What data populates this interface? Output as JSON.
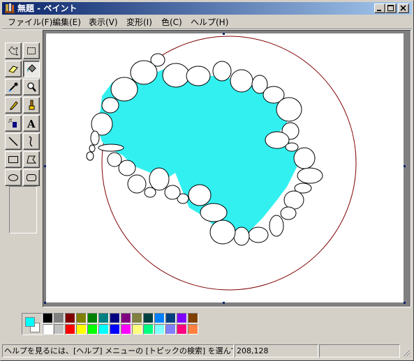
{
  "window": {
    "title": "無題 - ペイント",
    "app_icon": "paint-icon",
    "controls": [
      "minimize-icon",
      "maximize-icon",
      "close-icon"
    ]
  },
  "menu": [
    {
      "label": "ファイル(F)"
    },
    {
      "label": "編集(E)"
    },
    {
      "label": "表示(V)"
    },
    {
      "label": "変形(I)"
    },
    {
      "label": "色(C)"
    },
    {
      "label": "ヘルプ(H)"
    }
  ],
  "tools": [
    {
      "name": "free-select-icon",
      "active": false
    },
    {
      "name": "rect-select-icon",
      "active": false
    },
    {
      "name": "eraser-icon",
      "active": false
    },
    {
      "name": "fill-bucket-icon",
      "active": true
    },
    {
      "name": "color-picker-icon",
      "active": false
    },
    {
      "name": "magnifier-icon",
      "active": false
    },
    {
      "name": "pencil-icon",
      "active": false
    },
    {
      "name": "brush-icon",
      "active": false
    },
    {
      "name": "airbrush-icon",
      "active": false
    },
    {
      "name": "text-icon",
      "active": false,
      "glyph": "A"
    },
    {
      "name": "line-icon",
      "active": false
    },
    {
      "name": "curve-icon",
      "active": false
    },
    {
      "name": "rectangle-icon",
      "active": false
    },
    {
      "name": "polygon-icon",
      "active": false
    },
    {
      "name": "ellipse-icon",
      "active": false
    },
    {
      "name": "rounded-rect-icon",
      "active": false
    }
  ],
  "colors": {
    "foreground": "#00ffff",
    "background": "#ffffff",
    "fill": "#33f0f0",
    "circle_stroke": "#800000",
    "palette_row1": [
      "#000000",
      "#808080",
      "#800000",
      "#808000",
      "#008000",
      "#008080",
      "#000080",
      "#800080",
      "#808040",
      "#004040",
      "#0080ff",
      "#004080",
      "#8000ff",
      "#804000"
    ],
    "palette_row2": [
      "#ffffff",
      "#c0c0c0",
      "#ff0000",
      "#ffff00",
      "#00ff00",
      "#00ffff",
      "#0000ff",
      "#ff00ff",
      "#ffff80",
      "#00ff80",
      "#80ffff",
      "#8080ff",
      "#ff0080",
      "#ff8040"
    ]
  },
  "status": {
    "help_text": "ヘルプを見るには、[ヘルプ] メニューの [トピックの検索] を選んでください。",
    "coordinates": "208,128",
    "size": ""
  }
}
